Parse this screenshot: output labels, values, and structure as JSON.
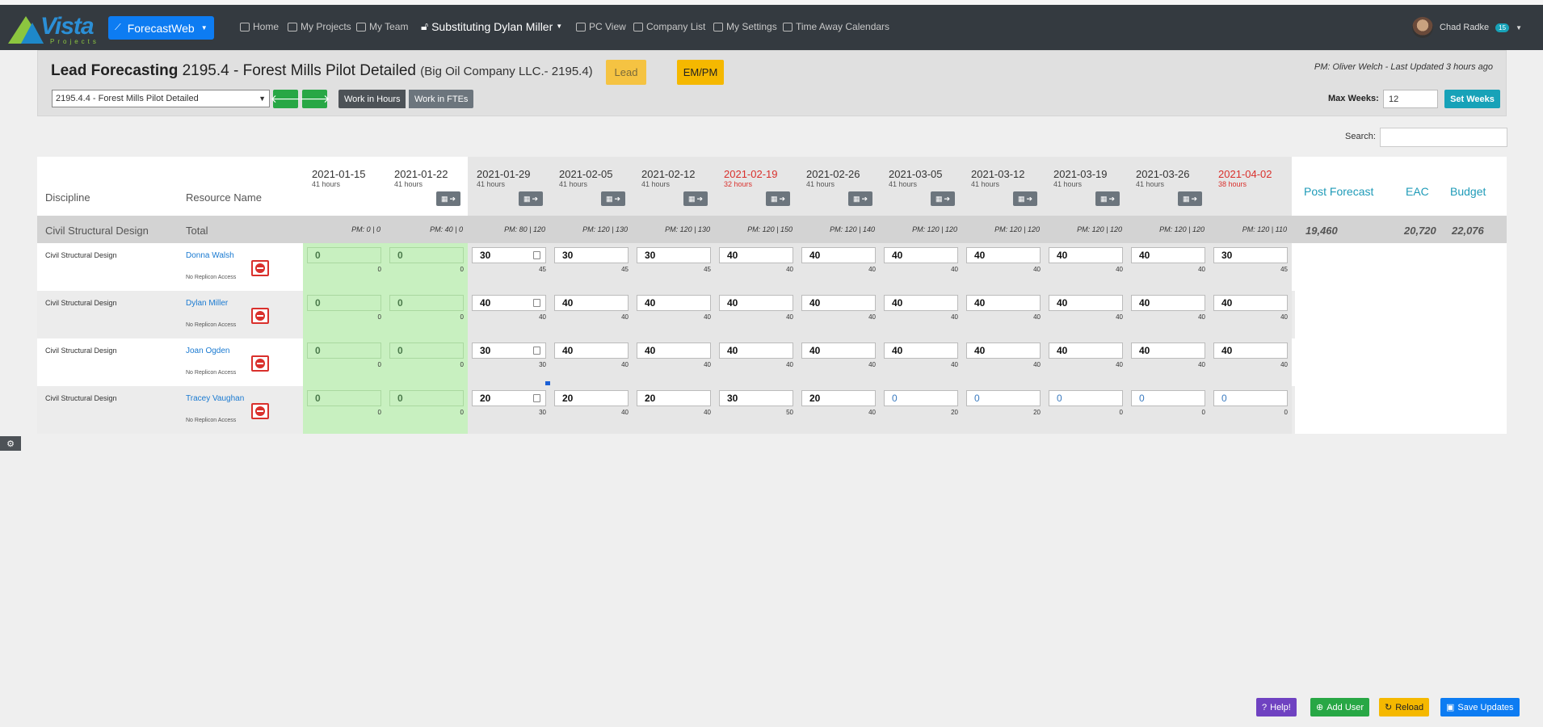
{
  "nav": {
    "logo_text": "Vista",
    "logo_sub": "Projects",
    "app_button": "ForecastWeb",
    "home": "Home",
    "my_projects": "My Projects",
    "my_team": "My Team",
    "substituting": "Substituting Dylan Miller",
    "pc_view": "PC View",
    "company_list": "Company List",
    "my_settings": "My Settings",
    "time_away": "Time Away Calendars",
    "user_name": "Chad Radke",
    "user_badge": "15"
  },
  "header": {
    "title_bold": "Lead Forecasting",
    "title_project": "2195.4 - Forest Mills Pilot Detailed",
    "title_company": "(Big Oil Company LLC.- 2195.4)",
    "lead_btn": "Lead",
    "empm_btn": "EM/PM",
    "pm_info": "PM: Oliver Welch - Last Updated 3 hours ago",
    "project_select": "2195.4.4 - Forest Mills Pilot Detailed",
    "work_hours": "Work in Hours",
    "work_ftes": "Work in FTEs",
    "max_weeks_label": "Max Weeks:",
    "max_weeks_value": "12",
    "set_weeks": "Set Weeks"
  },
  "search_label": "Search:",
  "columns": {
    "discipline": "Discipline",
    "resource": "Resource Name",
    "post_forecast": "Post Forecast",
    "eac": "EAC",
    "budget": "Budget"
  },
  "weeks": [
    {
      "date": "2021-01-15",
      "hours": "41 hours",
      "red": false
    },
    {
      "date": "2021-01-22",
      "hours": "41 hours",
      "red": false
    },
    {
      "date": "2021-01-29",
      "hours": "41 hours",
      "red": false
    },
    {
      "date": "2021-02-05",
      "hours": "41 hours",
      "red": false
    },
    {
      "date": "2021-02-12",
      "hours": "41 hours",
      "red": false
    },
    {
      "date": "2021-02-19",
      "hours": "32 hours",
      "red": true
    },
    {
      "date": "2021-02-26",
      "hours": "41 hours",
      "red": false
    },
    {
      "date": "2021-03-05",
      "hours": "41 hours",
      "red": false
    },
    {
      "date": "2021-03-12",
      "hours": "41 hours",
      "red": false
    },
    {
      "date": "2021-03-19",
      "hours": "41 hours",
      "red": false
    },
    {
      "date": "2021-03-26",
      "hours": "41 hours",
      "red": false
    },
    {
      "date": "2021-04-02",
      "hours": "38 hours",
      "red": true
    }
  ],
  "total": {
    "discipline": "Civil Structural Design",
    "label": "Total",
    "pm": [
      "PM: 0 | 0",
      "PM: 40 | 0",
      "PM: 80 | 120",
      "PM: 120 | 130",
      "PM: 120 | 130",
      "PM: 120 | 150",
      "PM: 120 | 140",
      "PM: 120 | 120",
      "PM: 120 | 120",
      "PM: 120 | 120",
      "PM: 120 | 120",
      "PM: 120 | 110"
    ],
    "post_forecast": "19,460",
    "eac": "20,720",
    "budget": "22,076"
  },
  "rows": [
    {
      "discipline": "Civil Structural Design",
      "name": "Donna Walsh",
      "note": "No Replicon Access",
      "values": [
        "0",
        "0",
        "30",
        "30",
        "30",
        "40",
        "40",
        "40",
        "40",
        "40",
        "40",
        "30"
      ],
      "subs": [
        "0",
        "0",
        "45",
        "45",
        "45",
        "40",
        "40",
        "40",
        "40",
        "40",
        "40",
        "45"
      ]
    },
    {
      "discipline": "Civil Structural Design",
      "name": "Dylan Miller",
      "note": "No Replicon Access",
      "values": [
        "0",
        "0",
        "40",
        "40",
        "40",
        "40",
        "40",
        "40",
        "40",
        "40",
        "40",
        "40"
      ],
      "subs": [
        "0",
        "0",
        "40",
        "40",
        "40",
        "40",
        "40",
        "40",
        "40",
        "40",
        "40",
        "40"
      ]
    },
    {
      "discipline": "Civil Structural Design",
      "name": "Joan Ogden",
      "note": "No Replicon Access",
      "values": [
        "0",
        "0",
        "30",
        "40",
        "40",
        "40",
        "40",
        "40",
        "40",
        "40",
        "40",
        "40"
      ],
      "subs": [
        "0",
        "0",
        "30",
        "40",
        "40",
        "40",
        "40",
        "40",
        "40",
        "40",
        "40",
        "40"
      ]
    },
    {
      "discipline": "Civil Structural Design",
      "name": "Tracey Vaughan",
      "note": "No Replicon Access",
      "values": [
        "0",
        "0",
        "20",
        "20",
        "20",
        "30",
        "20",
        "0",
        "0",
        "0",
        "0",
        "0"
      ],
      "subs": [
        "0",
        "0",
        "30",
        "40",
        "40",
        "50",
        "40",
        "20",
        "20",
        "0",
        "0",
        "0"
      ]
    }
  ],
  "footer": {
    "help": "Help!",
    "add_user": "Add User",
    "reload": "Reload",
    "save": "Save Updates"
  }
}
